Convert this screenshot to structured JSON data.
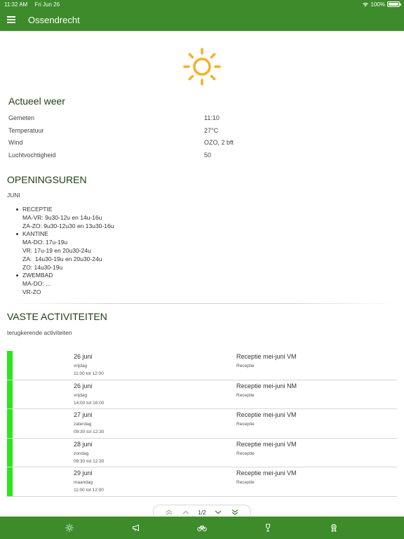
{
  "status": {
    "time": "11:32 AM",
    "date": "Fri Jun 26",
    "battery": "100%"
  },
  "app": {
    "title": "Ossendrecht"
  },
  "weather": {
    "title": "Actueel weer",
    "rows": [
      {
        "label": "Gemeten",
        "value": "11:10"
      },
      {
        "label": "Temperatuur",
        "value": "27°C"
      },
      {
        "label": "Wind",
        "value": "OZO, 2 bft"
      },
      {
        "label": "Luchtvochtigheid",
        "value": "50"
      }
    ]
  },
  "opening": {
    "title": "OPENINGSUREN",
    "month": "JUNI",
    "groups": [
      {
        "name": "RECEPTIE",
        "lines": [
          "MA-VR: 9u30-12u en 14u-16u",
          "ZA-ZO: 9u30-12u30 en 13u30-16u"
        ]
      },
      {
        "name": "KANTINE",
        "lines": [
          "MA-DO: 17u-19u",
          "VR: 17u-19 en 20u30-24u",
          "ZA:  14u30-19u en 20u30-24u",
          "ZO: 14u30-19u"
        ]
      },
      {
        "name": "ZWEMBAD",
        "lines": [
          "MA-DO: ...",
          "VR-ZO"
        ]
      }
    ]
  },
  "activities": {
    "title": "VASTE ACTIVITEITEN",
    "subtitle": "terugkerende activiteiten",
    "items": [
      {
        "date": "26 juni",
        "day": "vrijdag",
        "time": "11:00 tot 12:00",
        "name": "Receptie mei-juni VM",
        "category": "Receptie"
      },
      {
        "date": "26 juni",
        "day": "vrijdag",
        "time": "14:00 tot 16:00",
        "name": "Receptie mei-juni NM",
        "category": "Receptie"
      },
      {
        "date": "27 juni",
        "day": "zaterdag",
        "time": "09:30 tot 12:30",
        "name": "Receptie mei-juni VM",
        "category": "Receptie"
      },
      {
        "date": "28 juni",
        "day": "zondag",
        "time": "09:30 tot 12:30",
        "name": "Receptie mei-juni VM",
        "category": "Receptie"
      },
      {
        "date": "29 juni",
        "day": "maandag",
        "time": "11:00 tot 12:00",
        "name": "Receptie mei-juni VM",
        "category": "Receptie"
      }
    ],
    "accent": "#2ee51d"
  },
  "pager": {
    "label": "1/2"
  },
  "bottom_nav": {
    "icons": [
      "sun-icon",
      "megaphone-icon",
      "bicycle-icon",
      "wine-glass-icon",
      "award-icon"
    ]
  },
  "colors": {
    "brand": "#3d8b2a",
    "sun": "#f6b026",
    "heading": "#1e3d14"
  }
}
